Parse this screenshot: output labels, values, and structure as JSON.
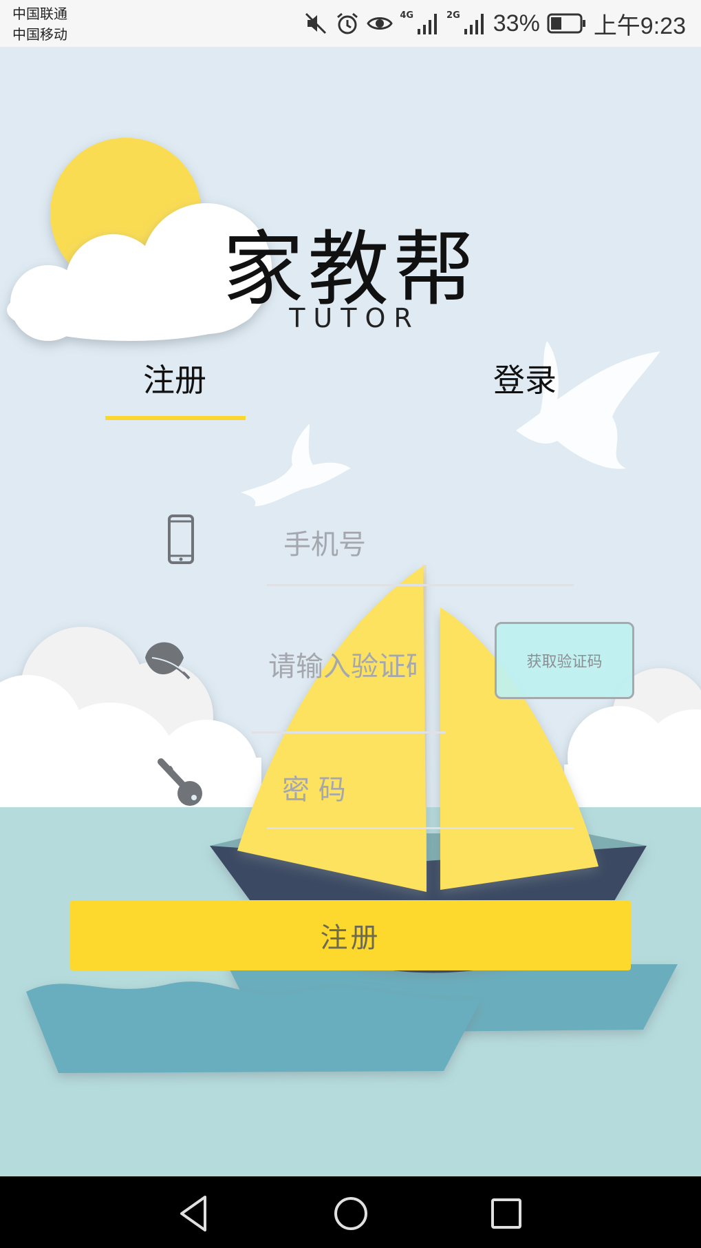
{
  "status_bar": {
    "carrier1": "中国联通",
    "carrier2": "中国移动",
    "net1": "4G",
    "net2": "2G",
    "battery": "33%",
    "time": "上午9:23"
  },
  "header": {
    "title": "家教帮",
    "subtitle": "TUTOR"
  },
  "tabs": [
    {
      "label": "注册",
      "active": true
    },
    {
      "label": "登录",
      "active": false
    }
  ],
  "form": {
    "phone_placeholder": "手机号",
    "code_placeholder": "请输入验证码",
    "get_code_label": "获取验证码",
    "password_placeholder": "密 码",
    "submit_label": "注册"
  },
  "colors": {
    "accent": "#fcd72d",
    "sky": "#dfeaf2",
    "sea": "#b5dbdc",
    "icon_gray": "#707478"
  },
  "icons": [
    "mute-icon",
    "alarm-icon",
    "eye-icon",
    "signal-icon",
    "battery-icon",
    "phone-icon",
    "leaf-icon",
    "key-icon",
    "back-icon",
    "home-icon",
    "recents-icon"
  ]
}
